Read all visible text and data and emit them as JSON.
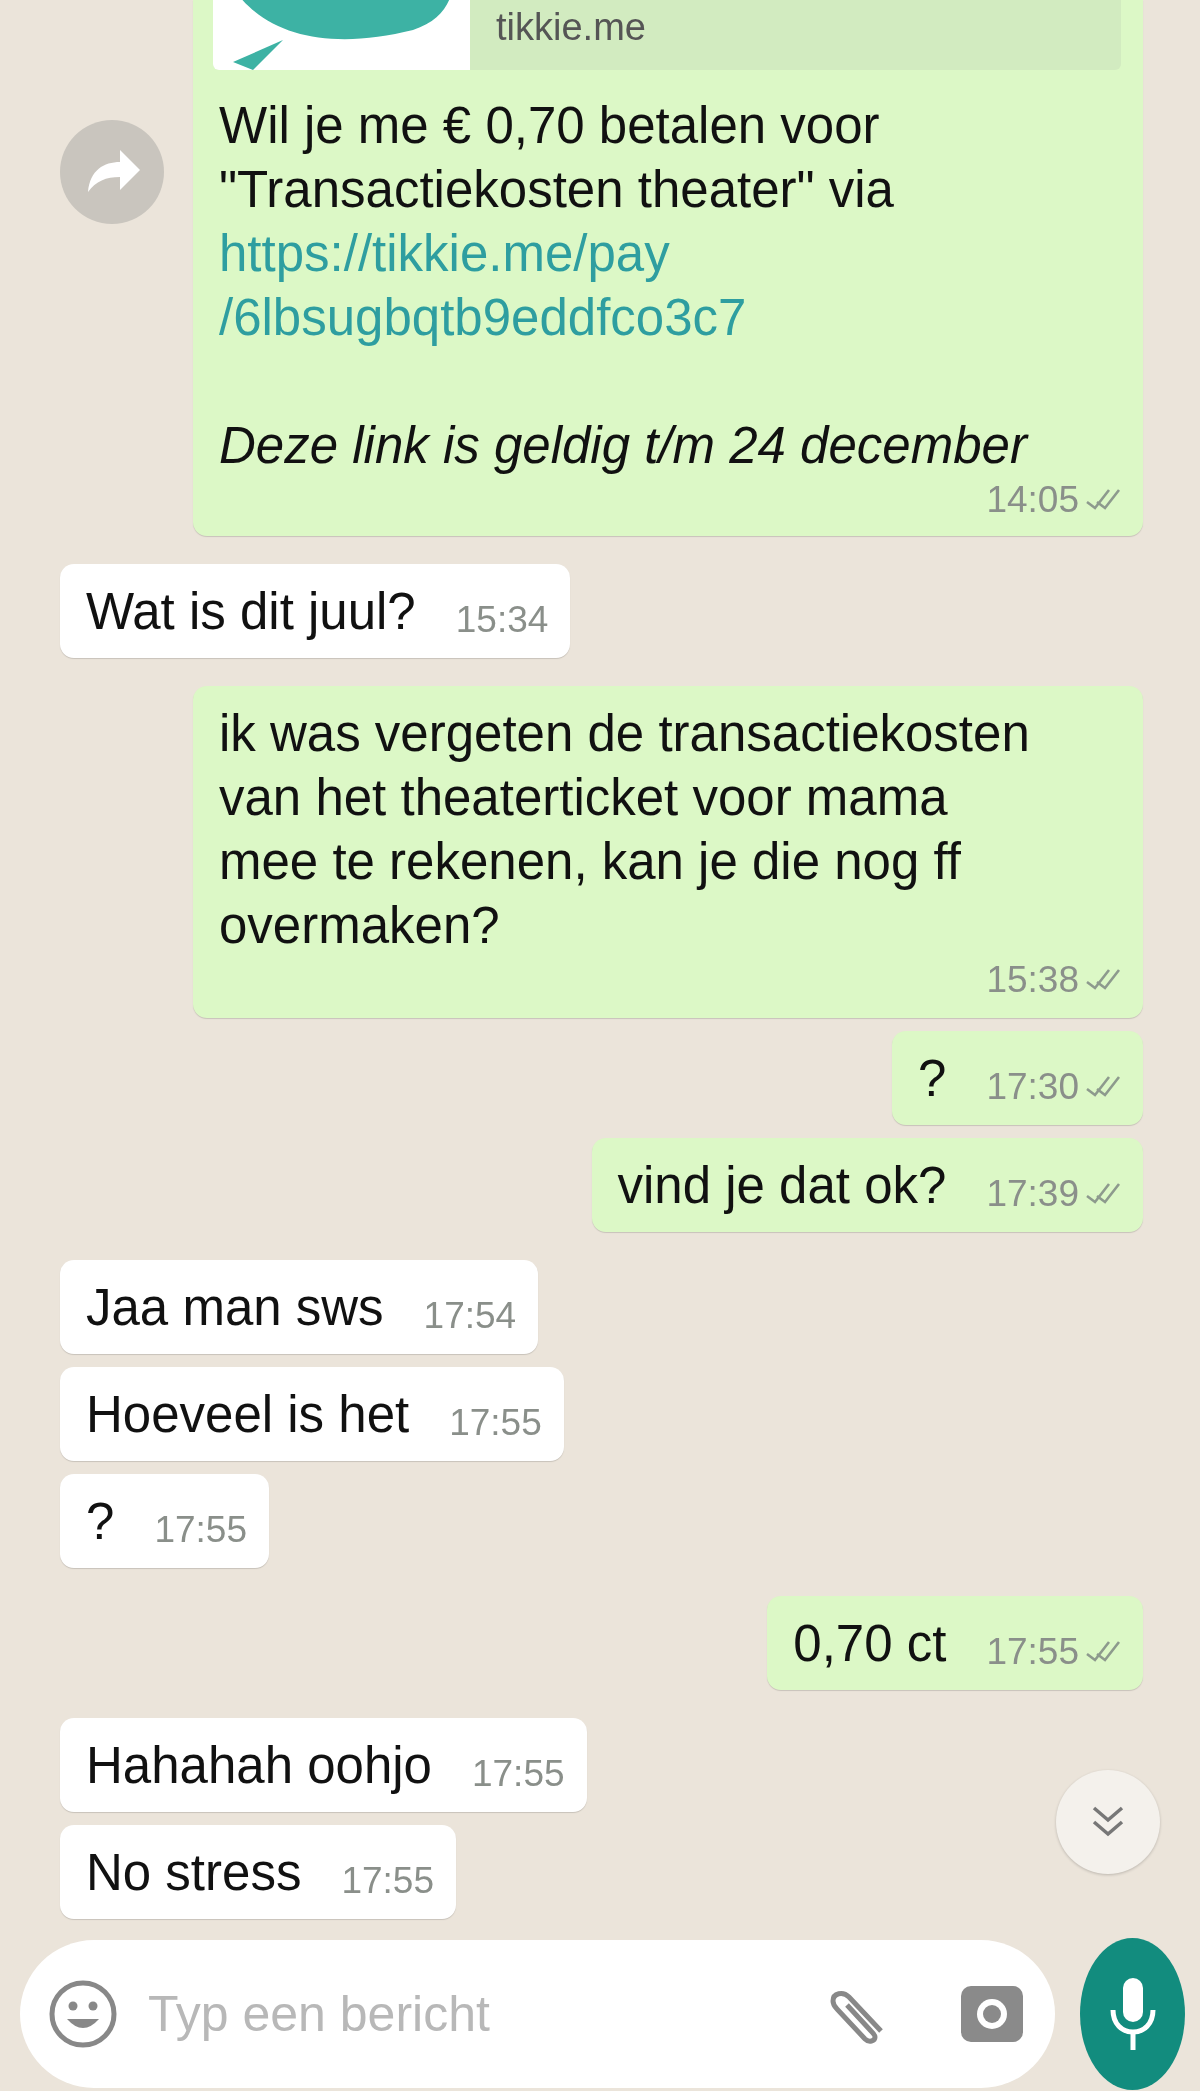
{
  "messages": [
    {
      "outgoing": true,
      "kind": "payment",
      "preview_domain": "tikkie.me",
      "text_lines": [
        "Wil je me € 0,70 betalen voor",
        "\"Transactiekosten theater\" via"
      ],
      "link_lines": [
        "https://tikkie.me/pay",
        "/6lbsugbqtb9eddfco3c7"
      ],
      "note": "Deze link is geldig t/m 24 december",
      "time": "14:05",
      "read": false
    },
    {
      "outgoing": false,
      "kind": "text",
      "text_lines": [
        "Wat is dit juul?"
      ],
      "time": "15:34"
    },
    {
      "outgoing": true,
      "kind": "text",
      "text_lines": [
        "ik was vergeten de transactiekosten",
        "van het theaterticket voor mama",
        "mee te rekenen, kan je die nog ff",
        "overmaken?"
      ],
      "time": "15:38",
      "read": false
    },
    {
      "outgoing": true,
      "kind": "text",
      "text_lines": [
        "?"
      ],
      "time": "17:30",
      "read": false
    },
    {
      "outgoing": true,
      "kind": "text",
      "text_lines": [
        "vind je dat ok?"
      ],
      "time": "17:39",
      "read": false
    },
    {
      "outgoing": false,
      "kind": "text",
      "text_lines": [
        "Jaa man sws"
      ],
      "time": "17:54"
    },
    {
      "outgoing": false,
      "kind": "text",
      "text_lines": [
        "Hoeveel is het"
      ],
      "time": "17:55"
    },
    {
      "outgoing": false,
      "kind": "text",
      "text_lines": [
        "?"
      ],
      "time": "17:55"
    },
    {
      "outgoing": true,
      "kind": "text",
      "text_lines": [
        "0,70 ct"
      ],
      "time": "17:55",
      "read": false
    },
    {
      "outgoing": false,
      "kind": "text",
      "text_lines": [
        "Hahahah oohjo"
      ],
      "time": "17:55"
    },
    {
      "outgoing": false,
      "kind": "text",
      "text_lines": [
        "No stress"
      ],
      "time": "17:55"
    }
  ],
  "composer": {
    "placeholder": "Typ een bericht"
  }
}
